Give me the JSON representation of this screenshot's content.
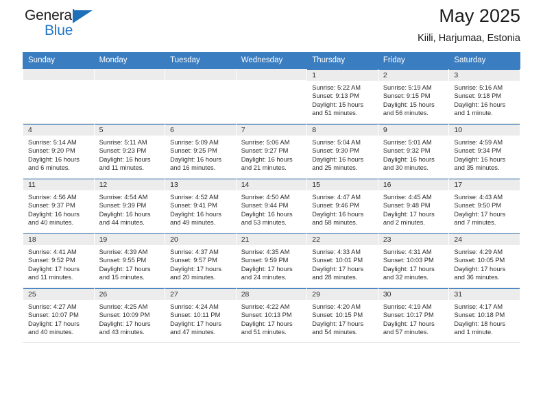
{
  "brand": {
    "name_part1": "General",
    "name_part2": "Blue",
    "accent_color": "#2176c7",
    "header_color": "#3a7dc0"
  },
  "header": {
    "title": "May 2025",
    "subtitle": "Kiili, Harjumaa, Estonia"
  },
  "weekdays": [
    "Sunday",
    "Monday",
    "Tuesday",
    "Wednesday",
    "Thursday",
    "Friday",
    "Saturday"
  ],
  "weeks": [
    [
      {
        "day": "",
        "sunrise": "",
        "sunset": "",
        "daylight": ""
      },
      {
        "day": "",
        "sunrise": "",
        "sunset": "",
        "daylight": ""
      },
      {
        "day": "",
        "sunrise": "",
        "sunset": "",
        "daylight": ""
      },
      {
        "day": "",
        "sunrise": "",
        "sunset": "",
        "daylight": ""
      },
      {
        "day": "1",
        "sunrise": "Sunrise: 5:22 AM",
        "sunset": "Sunset: 9:13 PM",
        "daylight": "Daylight: 15 hours and 51 minutes."
      },
      {
        "day": "2",
        "sunrise": "Sunrise: 5:19 AM",
        "sunset": "Sunset: 9:15 PM",
        "daylight": "Daylight: 15 hours and 56 minutes."
      },
      {
        "day": "3",
        "sunrise": "Sunrise: 5:16 AM",
        "sunset": "Sunset: 9:18 PM",
        "daylight": "Daylight: 16 hours and 1 minute."
      }
    ],
    [
      {
        "day": "4",
        "sunrise": "Sunrise: 5:14 AM",
        "sunset": "Sunset: 9:20 PM",
        "daylight": "Daylight: 16 hours and 6 minutes."
      },
      {
        "day": "5",
        "sunrise": "Sunrise: 5:11 AM",
        "sunset": "Sunset: 9:23 PM",
        "daylight": "Daylight: 16 hours and 11 minutes."
      },
      {
        "day": "6",
        "sunrise": "Sunrise: 5:09 AM",
        "sunset": "Sunset: 9:25 PM",
        "daylight": "Daylight: 16 hours and 16 minutes."
      },
      {
        "day": "7",
        "sunrise": "Sunrise: 5:06 AM",
        "sunset": "Sunset: 9:27 PM",
        "daylight": "Daylight: 16 hours and 21 minutes."
      },
      {
        "day": "8",
        "sunrise": "Sunrise: 5:04 AM",
        "sunset": "Sunset: 9:30 PM",
        "daylight": "Daylight: 16 hours and 25 minutes."
      },
      {
        "day": "9",
        "sunrise": "Sunrise: 5:01 AM",
        "sunset": "Sunset: 9:32 PM",
        "daylight": "Daylight: 16 hours and 30 minutes."
      },
      {
        "day": "10",
        "sunrise": "Sunrise: 4:59 AM",
        "sunset": "Sunset: 9:34 PM",
        "daylight": "Daylight: 16 hours and 35 minutes."
      }
    ],
    [
      {
        "day": "11",
        "sunrise": "Sunrise: 4:56 AM",
        "sunset": "Sunset: 9:37 PM",
        "daylight": "Daylight: 16 hours and 40 minutes."
      },
      {
        "day": "12",
        "sunrise": "Sunrise: 4:54 AM",
        "sunset": "Sunset: 9:39 PM",
        "daylight": "Daylight: 16 hours and 44 minutes."
      },
      {
        "day": "13",
        "sunrise": "Sunrise: 4:52 AM",
        "sunset": "Sunset: 9:41 PM",
        "daylight": "Daylight: 16 hours and 49 minutes."
      },
      {
        "day": "14",
        "sunrise": "Sunrise: 4:50 AM",
        "sunset": "Sunset: 9:44 PM",
        "daylight": "Daylight: 16 hours and 53 minutes."
      },
      {
        "day": "15",
        "sunrise": "Sunrise: 4:47 AM",
        "sunset": "Sunset: 9:46 PM",
        "daylight": "Daylight: 16 hours and 58 minutes."
      },
      {
        "day": "16",
        "sunrise": "Sunrise: 4:45 AM",
        "sunset": "Sunset: 9:48 PM",
        "daylight": "Daylight: 17 hours and 2 minutes."
      },
      {
        "day": "17",
        "sunrise": "Sunrise: 4:43 AM",
        "sunset": "Sunset: 9:50 PM",
        "daylight": "Daylight: 17 hours and 7 minutes."
      }
    ],
    [
      {
        "day": "18",
        "sunrise": "Sunrise: 4:41 AM",
        "sunset": "Sunset: 9:52 PM",
        "daylight": "Daylight: 17 hours and 11 minutes."
      },
      {
        "day": "19",
        "sunrise": "Sunrise: 4:39 AM",
        "sunset": "Sunset: 9:55 PM",
        "daylight": "Daylight: 17 hours and 15 minutes."
      },
      {
        "day": "20",
        "sunrise": "Sunrise: 4:37 AM",
        "sunset": "Sunset: 9:57 PM",
        "daylight": "Daylight: 17 hours and 20 minutes."
      },
      {
        "day": "21",
        "sunrise": "Sunrise: 4:35 AM",
        "sunset": "Sunset: 9:59 PM",
        "daylight": "Daylight: 17 hours and 24 minutes."
      },
      {
        "day": "22",
        "sunrise": "Sunrise: 4:33 AM",
        "sunset": "Sunset: 10:01 PM",
        "daylight": "Daylight: 17 hours and 28 minutes."
      },
      {
        "day": "23",
        "sunrise": "Sunrise: 4:31 AM",
        "sunset": "Sunset: 10:03 PM",
        "daylight": "Daylight: 17 hours and 32 minutes."
      },
      {
        "day": "24",
        "sunrise": "Sunrise: 4:29 AM",
        "sunset": "Sunset: 10:05 PM",
        "daylight": "Daylight: 17 hours and 36 minutes."
      }
    ],
    [
      {
        "day": "25",
        "sunrise": "Sunrise: 4:27 AM",
        "sunset": "Sunset: 10:07 PM",
        "daylight": "Daylight: 17 hours and 40 minutes."
      },
      {
        "day": "26",
        "sunrise": "Sunrise: 4:25 AM",
        "sunset": "Sunset: 10:09 PM",
        "daylight": "Daylight: 17 hours and 43 minutes."
      },
      {
        "day": "27",
        "sunrise": "Sunrise: 4:24 AM",
        "sunset": "Sunset: 10:11 PM",
        "daylight": "Daylight: 17 hours and 47 minutes."
      },
      {
        "day": "28",
        "sunrise": "Sunrise: 4:22 AM",
        "sunset": "Sunset: 10:13 PM",
        "daylight": "Daylight: 17 hours and 51 minutes."
      },
      {
        "day": "29",
        "sunrise": "Sunrise: 4:20 AM",
        "sunset": "Sunset: 10:15 PM",
        "daylight": "Daylight: 17 hours and 54 minutes."
      },
      {
        "day": "30",
        "sunrise": "Sunrise: 4:19 AM",
        "sunset": "Sunset: 10:17 PM",
        "daylight": "Daylight: 17 hours and 57 minutes."
      },
      {
        "day": "31",
        "sunrise": "Sunrise: 4:17 AM",
        "sunset": "Sunset: 10:18 PM",
        "daylight": "Daylight: 18 hours and 1 minute."
      }
    ]
  ]
}
